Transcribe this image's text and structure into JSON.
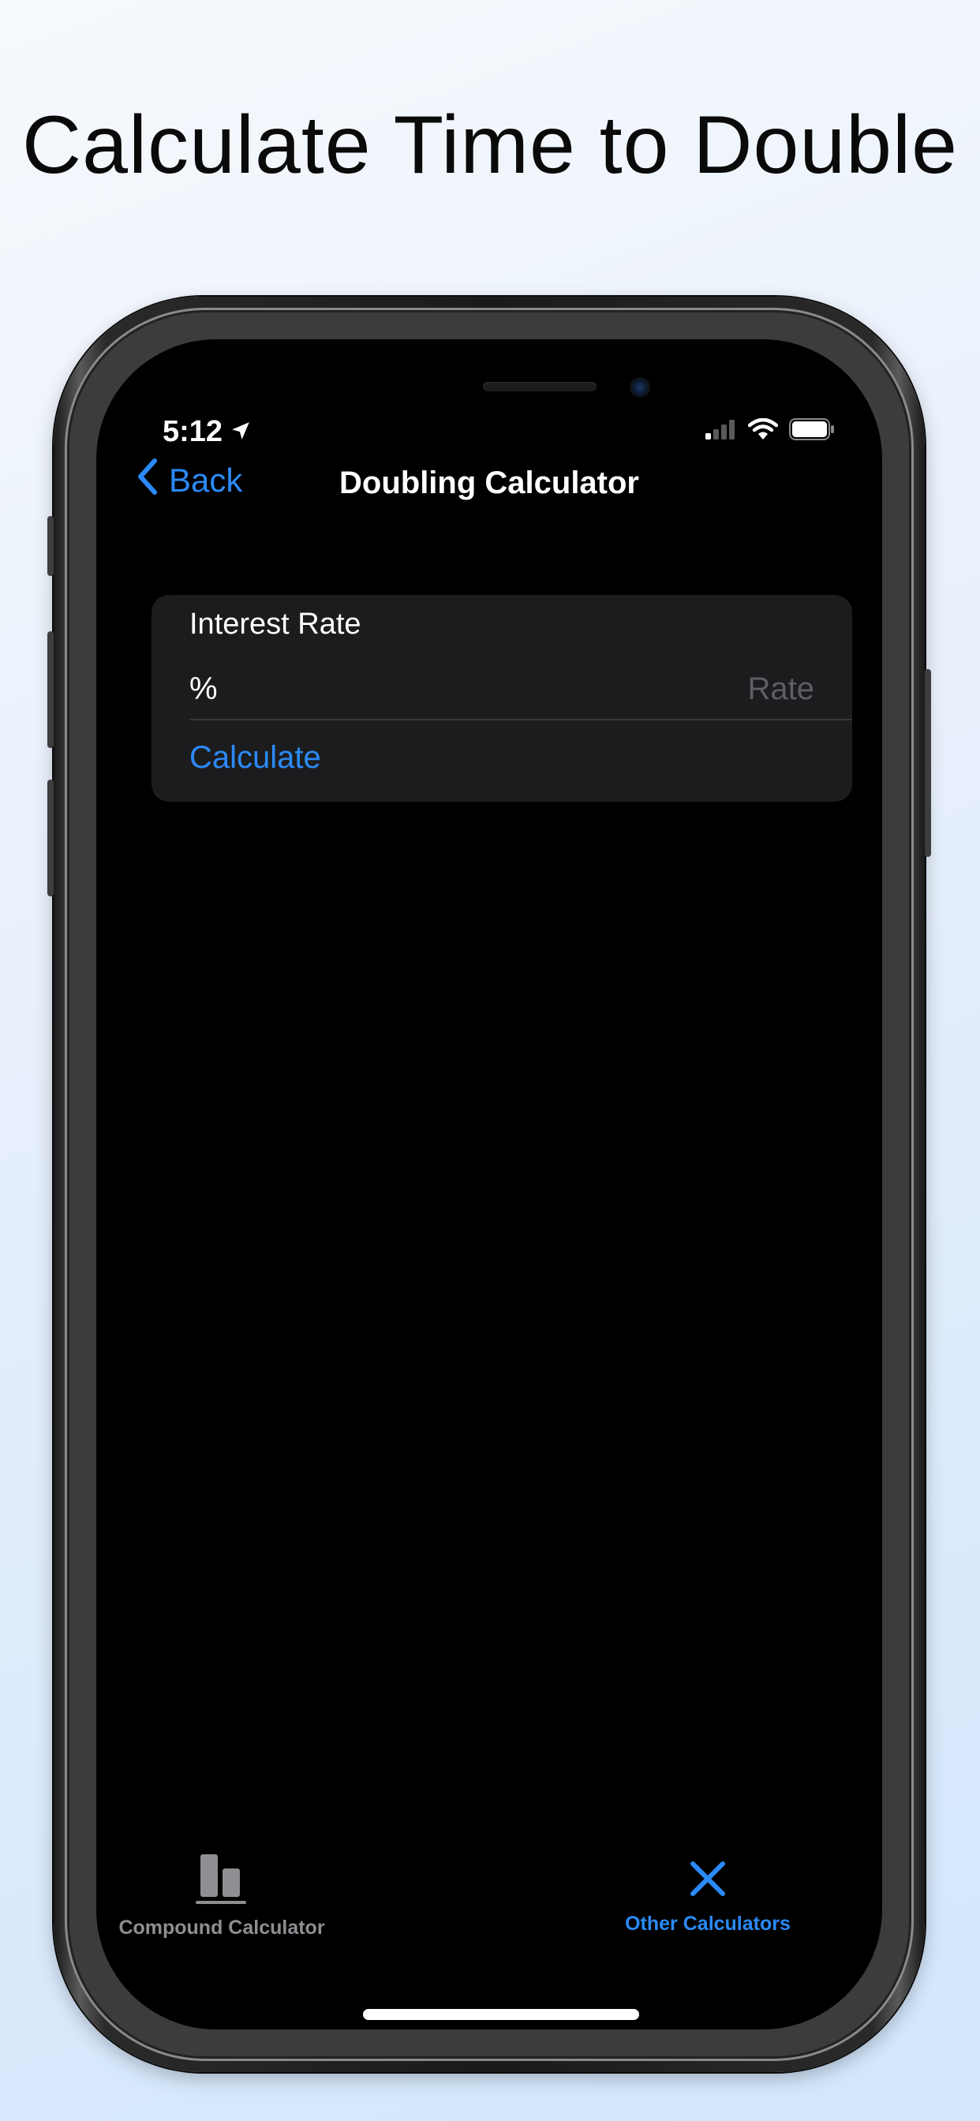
{
  "headline": "Calculate Time to Double",
  "status_bar": {
    "time": "5:12",
    "icons": [
      "location-arrow-icon",
      "cellular-signal-icon",
      "wifi-icon",
      "battery-icon"
    ]
  },
  "nav": {
    "back_label": "Back",
    "title": "Doubling Calculator"
  },
  "form": {
    "section_label": "Interest Rate",
    "rate_unit": "%",
    "rate_value": "",
    "rate_placeholder": "Rate",
    "calculate_label": "Calculate"
  },
  "tab_bar": {
    "tabs": [
      {
        "label": "Compound Calculator",
        "icon": "bar-chart-icon",
        "selected": false
      },
      {
        "label": "Other Calculators",
        "icon": "x-icon",
        "selected": true
      }
    ]
  },
  "colors": {
    "accent": "#2b8af7",
    "screen_background": "#000000",
    "card_background": "#1c1c1e",
    "inactive_tab": "#8e8e93",
    "placeholder": "#5e5e63"
  }
}
